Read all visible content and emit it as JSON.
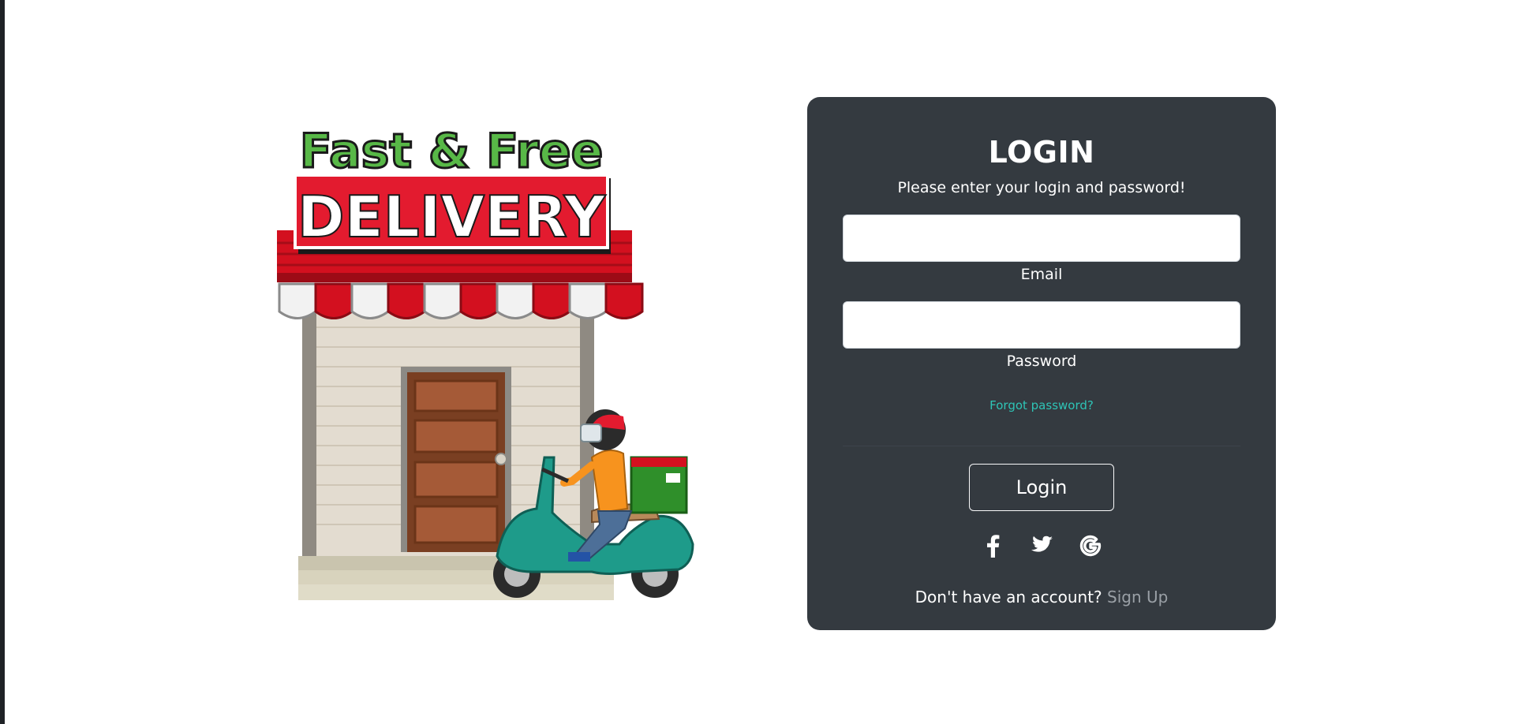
{
  "illustration": {
    "headline_top": "Fast & Free",
    "headline_bottom": "DELIVERY",
    "icon": "delivery-shop-illustration"
  },
  "login": {
    "title": "LOGIN",
    "subtitle": "Please enter your login and password!",
    "email_label": "Email",
    "email_value": "",
    "password_label": "Password",
    "password_value": "",
    "forgot_text": "Forgot password?",
    "login_button": "Login",
    "social_icons": [
      "facebook-icon",
      "twitter-icon",
      "google-icon"
    ],
    "signup_prompt": "Don't have an account?",
    "signup_link": "Sign Up"
  },
  "colors": {
    "card_bg": "#343a40",
    "accent_link": "#2ec4b6",
    "signup_link": "#9aa0a6"
  }
}
